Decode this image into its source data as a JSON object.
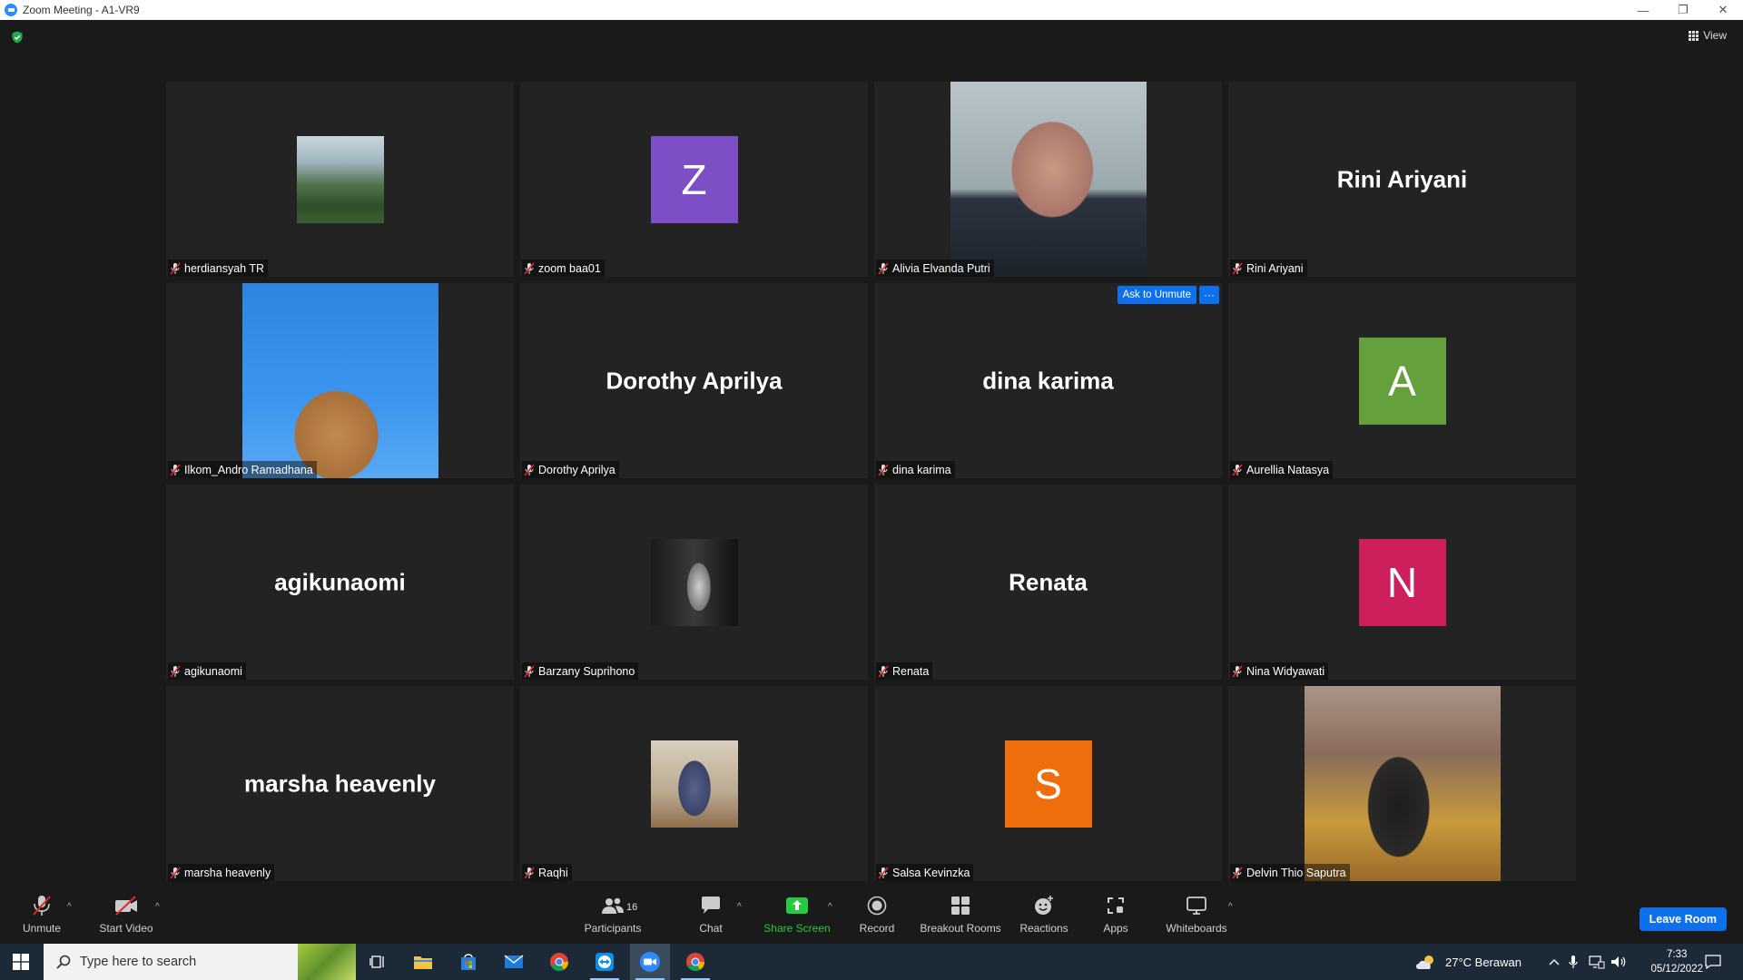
{
  "window": {
    "title": "Zoom Meeting - A1-VR9",
    "minimize_glyph": "—",
    "restore_glyph": "❐",
    "close_glyph": "✕"
  },
  "meeting": {
    "view_label": "View",
    "ask_to_unmute_label": "Ask to Unmute",
    "more_label": "···",
    "participants": [
      {
        "name": "herdiansyah TR",
        "display": "thumb",
        "image": "landscape-photo"
      },
      {
        "name": "zoom baa01",
        "display": "avatar",
        "initial": "Z",
        "color": "#7d4fc7"
      },
      {
        "name": "Alivia Elvanda Putri",
        "display": "video",
        "image": "portrait-photo"
      },
      {
        "name": "Rini Ariyani",
        "display": "name",
        "big_name": "Rini Ariyani"
      },
      {
        "name": "Ilkom_Andro Ramadhana",
        "display": "video",
        "image": "dog-photo"
      },
      {
        "name": "Dorothy Aprilya",
        "display": "name",
        "big_name": "Dorothy Aprilya"
      },
      {
        "name": "dina karima",
        "display": "name",
        "big_name": "dina karima",
        "hovered": true
      },
      {
        "name": "Aurellia Natasya",
        "display": "avatar",
        "initial": "A",
        "color": "#64a03c"
      },
      {
        "name": "agikunaomi",
        "display": "name",
        "big_name": "agikunaomi"
      },
      {
        "name": "Barzany Suprihono",
        "display": "thumb",
        "image": "bw-performer-photo"
      },
      {
        "name": "Renata",
        "display": "name",
        "big_name": "Renata"
      },
      {
        "name": "Nina Widyawati",
        "display": "avatar",
        "initial": "N",
        "color": "#cc1f5c"
      },
      {
        "name": "marsha heavenly",
        "display": "name",
        "big_name": "marsha heavenly"
      },
      {
        "name": "Raqhi",
        "display": "thumb",
        "image": "hooded-figure-photo"
      },
      {
        "name": "Salsa Kevinzka",
        "display": "avatar",
        "initial": "S",
        "color": "#ee6e0c"
      },
      {
        "name": "Delvin Thio Saputra",
        "display": "video",
        "image": "seated-person-photo"
      }
    ]
  },
  "toolbar": {
    "unmute": "Unmute",
    "start_video": "Start Video",
    "participants": "Participants",
    "participants_count": "16",
    "chat": "Chat",
    "share_screen": "Share Screen",
    "record": "Record",
    "breakout_rooms": "Breakout Rooms",
    "reactions": "Reactions",
    "apps": "Apps",
    "whiteboards": "Whiteboards",
    "leave_room": "Leave Room",
    "caret": "^",
    "share_color": "#27c93f",
    "accent_color": "#0e71eb"
  },
  "taskbar": {
    "search_placeholder": "Type here to search",
    "weather": "27°C  Berawan",
    "time": "7:33",
    "date": "05/12/2022",
    "apps": [
      "task-view-icon",
      "file-explorer-icon",
      "microsoft-store-icon",
      "mail-icon",
      "chrome-icon",
      "teamviewer-icon",
      "zoom-icon",
      "chrome-alt-icon"
    ]
  }
}
